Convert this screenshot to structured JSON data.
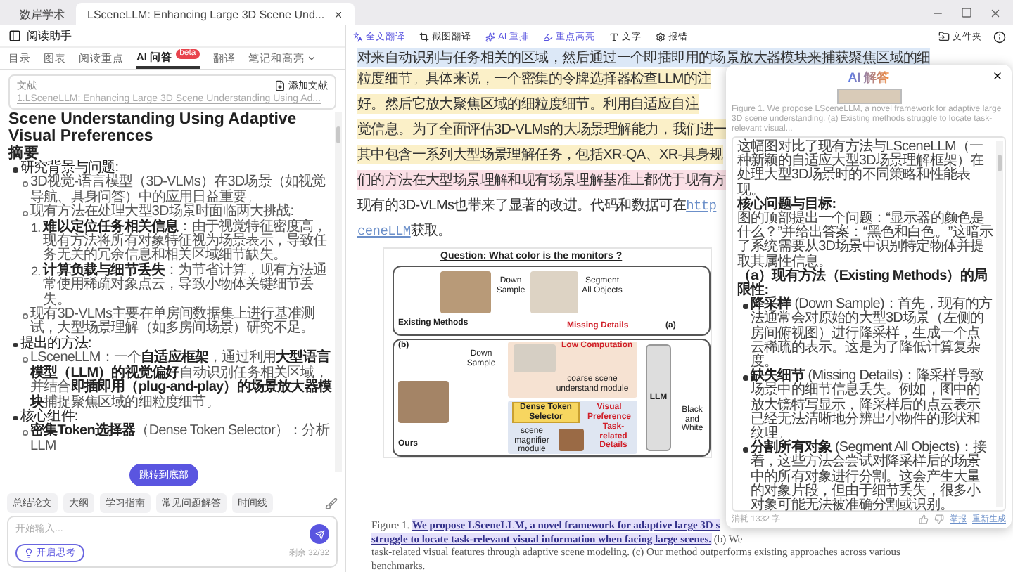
{
  "window": {
    "tabs": [
      {
        "label": "数岸学术",
        "selected": false
      },
      {
        "label": "LSceneLLM: Enhancing Large 3D Scene Und...",
        "selected": true
      }
    ]
  },
  "assistant": {
    "title": "阅读助手",
    "tabs": [
      {
        "label": "目录",
        "selected": false
      },
      {
        "label": "图表",
        "selected": false
      },
      {
        "label": "阅读重点",
        "selected": false
      },
      {
        "label": "AI 问答",
        "selected": true,
        "badge": "beta"
      },
      {
        "label": "翻译",
        "selected": false
      },
      {
        "label": "笔记和高亮",
        "selected": false,
        "dropdown": true
      }
    ],
    "document_field": {
      "legend": "文献",
      "action": "添加文献",
      "value": "1.LSceneLLM: Enhancing Large 3D Scene Understanding Using Ad..."
    },
    "summary": {
      "title": "Scene Understanding Using Adaptive Visual Preferences",
      "heading": "摘要",
      "items": [
        {
          "text": "研究背景与问题:",
          "children": [
            {
              "text": "3D视觉-语言模型（3D-VLMs）在3D场景（如视觉导航、具身问答）中的应用日益重要。"
            },
            {
              "text": "现有方法在处理大型3D场景时面临两大挑战:",
              "children": [
                {
                  "marker": "1.",
                  "text": "**难以定位任务相关信息**：由于视觉特征密度高，现有方法将所有对象特征视为场景表示，导致任务无关的冗余信息和相关区域细节缺失。"
                },
                {
                  "marker": "2.",
                  "text": "**计算负载与细节丢失**：为节省计算，现有方法通常使用稀疏对象点云，导致小物体关键细节丢失。"
                }
              ]
            },
            {
              "text": "现有3D-VLMs主要在单房间数据集上进行基准测试，大型场景理解（如多房间场景）研究不足。"
            }
          ]
        },
        {
          "text": "提出的方法:",
          "children": [
            {
              "text": "LSceneLLM：一个**自适应框架**，通过利用**大型语言模型（LLM）的视觉偏好**自动识别任务相关区域，并结合**即插即用（plug-and-play）的场景放大器模块**捕捉聚焦区域的细粒度细节。"
            }
          ]
        },
        {
          "text": "核心组件:",
          "children": [
            {
              "text": "**密集Token选择器**（Dense Token Selector）：分析LLM"
            }
          ]
        }
      ]
    },
    "jump_button": "跳转到底部",
    "chips": [
      "总结论文",
      "大纲",
      "学习指南",
      "常见问题解答",
      "时间线"
    ],
    "input": {
      "placeholder": "开始输入...",
      "think_button": "开启思考",
      "quota": "剩余 32/32"
    }
  },
  "toolbar": {
    "items": [
      {
        "label": "全文翻译",
        "kind": "translate"
      },
      {
        "label": "截图翻译",
        "kind": "crop"
      },
      {
        "label": "AI 重排",
        "kind": "ai"
      },
      {
        "label": "重点高亮",
        "kind": "highlight"
      },
      {
        "label": "文字",
        "kind": "text"
      },
      {
        "label": "报错",
        "kind": "settings"
      }
    ],
    "folder": "文件夹"
  },
  "document": {
    "lines": [
      {
        "color": "#dce8f7",
        "parts": [
          {
            "kind": "plain",
            "text": "对来自动识别与任务相关的区域，然后通过一个即插即用的场景放大器模块来捕获聚焦区域的细"
          }
        ]
      },
      {
        "color": "#fbf0c8",
        "parts": [
          {
            "kind": "plain",
            "text": "粒度细节。具体来说，一个密集的令牌选择器检查LLM的注"
          }
        ]
      },
      {
        "color": "#fbf0c8",
        "parts": [
          {
            "kind": "plain",
            "text": "好。然后它放大聚焦区域的细粒度细节。利用自适应自注"
          }
        ]
      },
      {
        "color": "#fbf0c8",
        "parts": [
          {
            "kind": "plain",
            "text": "觉信息。为了全面评估3D-VLMs的大场景理解能力，我们进一"
          }
        ]
      },
      {
        "color": "#fbf0c8",
        "parts": [
          {
            "kind": "plain",
            "text": "其中包含一系列大型场景理解任务，包括XR-QA、XR-具身规"
          }
        ]
      },
      {
        "color": "#fbe0e6",
        "parts": [
          {
            "kind": "plain",
            "text": "们的方法在大型场景理解和现有场景理解基准上都优于现有方"
          }
        ]
      },
      {
        "parts": [
          {
            "kind": "plain",
            "text": "现有的3D-VLMs也带来了显著的改进。代码和数据可在"
          },
          {
            "kind": "link",
            "text": "http"
          }
        ]
      },
      {
        "parts": [
          {
            "kind": "link",
            "text": "ceneLLM"
          },
          {
            "kind": "plain",
            "text": "获取。"
          }
        ]
      }
    ]
  },
  "figure": {
    "question": "Question: What color is the monitors ?",
    "labels": [
      {
        "kind": "label",
        "text": "Down Sample"
      },
      {
        "kind": "label",
        "text": "Segment All Objects"
      },
      {
        "kind": "title",
        "text": "Existing Methods"
      },
      {
        "kind": "note",
        "text": "Missing Details"
      },
      {
        "kind": "title",
        "text": "(a)"
      },
      {
        "kind": "title",
        "text": "(b)"
      },
      {
        "kind": "label",
        "text": "Down Sample"
      },
      {
        "kind": "note",
        "text": "Low Computation"
      },
      {
        "kind": "label",
        "text": "coarse scene understand module"
      },
      {
        "kind": "title",
        "text": "Ours"
      },
      {
        "kind": "box",
        "text": "Dense Token Selector"
      },
      {
        "kind": "note",
        "text": "Visual Preference"
      },
      {
        "kind": "label",
        "text": "scene magnifier module"
      },
      {
        "kind": "note",
        "text": "Task-related Details"
      },
      {
        "kind": "llm",
        "text": "LLM"
      },
      {
        "kind": "label",
        "text": "Black and White"
      }
    ]
  },
  "caption": {
    "lines": [
      [
        {
          "kind": "plain",
          "text": "Figure 1. "
        },
        {
          "kind": "highlight",
          "text": "We propose LSceneLLM, a novel framework for adaptive large 3D s"
        }
      ],
      [
        {
          "kind": "highlight",
          "text": "struggle to locate task-relevant visual information when facing large scenes."
        },
        {
          "kind": "plain",
          "text": " (b) We"
        }
      ],
      [
        {
          "kind": "plain",
          "text": "task-related visual features through adaptive scene modeling. (c) Our method outperforms existing approaches across various"
        }
      ],
      [
        {
          "kind": "plain",
          "text": "benchmarks."
        }
      ]
    ]
  },
  "answer_popup": {
    "title": "AI 解答",
    "caption": "Figure 1. We propose LSceneLLM, a novel framework for adaptive large 3D scene understanding. (a) Existing methods struggle to locate task-relevant visual...",
    "blocks": [
      {
        "kind": "paragraph",
        "text": "这幅图对比了现有方法与LSceneLLM（一种新颖的自适应大型3D场景理解框架）在处理大型3D场景时的不同策略和性能表现。"
      },
      {
        "kind": "heading",
        "text": "核心问题与目标:"
      },
      {
        "kind": "paragraph",
        "text": "图的顶部提出一个问题：“显示器的颜色是什么？”并给出答案：“黑色和白色。”这暗示了系统需要从3D场景中识别特定物体并提取其属性信息。"
      },
      {
        "kind": "heading",
        "text": "（a）现有方法（Existing Methods）的局限性:"
      },
      {
        "kind": "bullet",
        "text": "**降采样** (Down Sample)：首先，现有的方法通常会对原始的大型3D场景（左侧的房间俯视图）进行降采样，生成一个点云稀疏的表示。这是为了降低计算复杂度。"
      },
      {
        "kind": "bullet",
        "text": "**缺失细节** (Missing Details)：降采样导致场景中的细节信息丢失。例如，图中的放大镜特写显示，降采样后的点云表示已经无法清晰地分辨出小物件的形状和纹理。"
      },
      {
        "kind": "bullet",
        "text": "**分割所有对象** (Segment All Objects)：接着，这些方法会尝试对降采样后的场景中的所有对象进行分割。这会产生大量的对象片段，但由于细节丢失，很多小对象可能无法被准确分割或识别。"
      }
    ],
    "usage": "消耗 1332 字",
    "actions": [
      "举报",
      "重新生成"
    ]
  }
}
